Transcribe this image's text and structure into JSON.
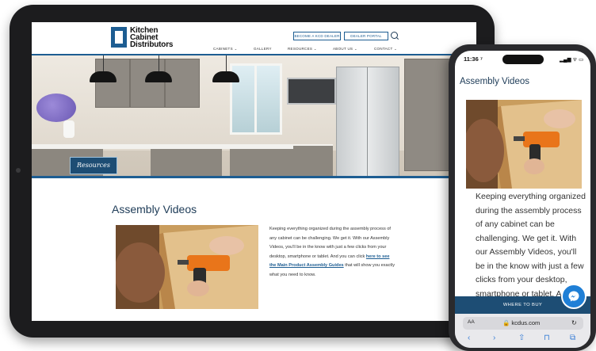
{
  "site": {
    "logo_lines": [
      "Kitchen",
      "Cabinet",
      "Distributors"
    ],
    "buttons": {
      "become_dealer": "BECOME A KCD DEALER",
      "dealer_portal": "DEALER PORTAL"
    },
    "nav": {
      "cabinets": "CABINETS ⌄",
      "gallery": "GALLERY",
      "resources": "RESOURCES ⌄",
      "about": "ABOUT US ⌄",
      "contact": "CONTACT ⌄"
    },
    "hero_badge": "Resources",
    "page_title": "Assembly Videos",
    "body_before_link": "Keeping everything organized during the assembly process of any cabinet can be challenging. We get it. With our Assembly Videos, you'll be in the know with just a few clicks from your desktop, smartphone or tablet. And you can click ",
    "body_link": "here to see the Main Product Assembly Guides",
    "body_after_link": " that will show you exactly what you need to know."
  },
  "phone": {
    "time": "11:36 ⁷",
    "status": "▂▄▆ ᯤ ▭",
    "title": "Assembly Videos",
    "text": "Keeping everything organized during the assembly process of any cabinet can be challenging. We get it. With our Assembly Videos, you'll be in the know with just a few clicks from your desktop, smartphone or tablet. And",
    "where_to_buy": "WHERE TO BUY",
    "aa": "AA",
    "url": "🔒 kcdus.com",
    "reload": "↻",
    "toolbar": {
      "back": "‹",
      "forward": "›",
      "share": "⇧",
      "bookmarks": "⊓",
      "tabs": "⧉"
    }
  },
  "icons": {
    "search": "search-icon",
    "chat": "messenger-icon",
    "lock": "lock-icon"
  },
  "colors": {
    "brand_blue": "#1d5d92",
    "navy": "#1d4d74",
    "device": "#1c1c1e"
  }
}
